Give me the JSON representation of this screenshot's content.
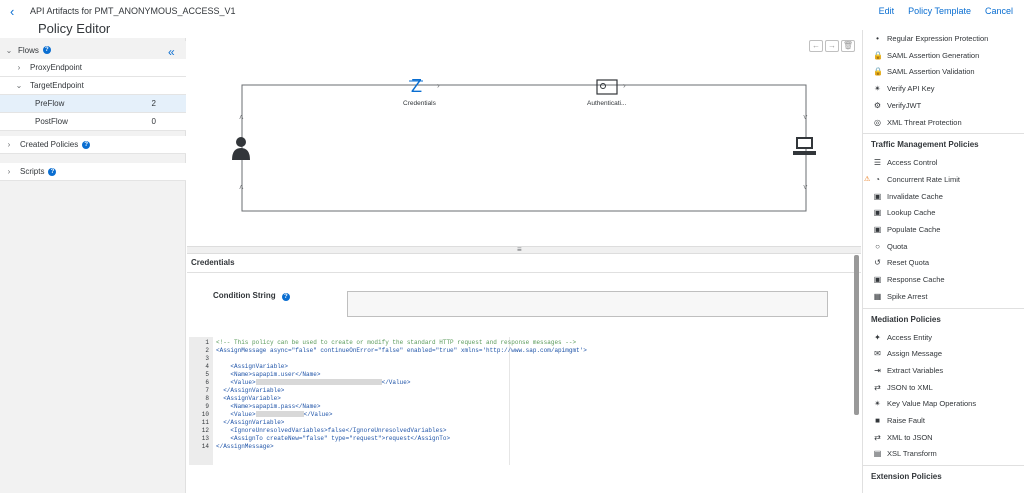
{
  "header": {
    "breadcrumb": "API Artifacts for PMT_ANONYMOUS_ACCESS_V1",
    "title": "Policy Editor",
    "actions": [
      "Edit",
      "Policy Template",
      "Cancel"
    ]
  },
  "sidebar": {
    "flows_label": "Flows",
    "proxy_endpoint": "ProxyEndpoint",
    "target_endpoint": "TargetEndpoint",
    "preflow": "PreFlow",
    "preflow_count": "2",
    "postflow": "PostFlow",
    "postflow_count": "0",
    "created_policies": "Created Policies",
    "scripts": "Scripts"
  },
  "flow": {
    "step1": "Credentials",
    "step2": "Authenticati..."
  },
  "detail": {
    "title": "Credentials",
    "condition_label": "Condition String",
    "condition_value": ""
  },
  "code_lines": [
    {
      "n": "1",
      "text": "<!-- This policy can be used to create or modify the standard HTTP request and response messages -->"
    },
    {
      "n": "2",
      "text": "<AssignMessage async=\"false\" continueOnError=\"false\" enabled=\"true\" xmlns='http://www.sap.com/apimgmt'>"
    },
    {
      "n": "3",
      "text": ""
    },
    {
      "n": "4",
      "text": "    <AssignVariable>"
    },
    {
      "n": "5",
      "text": "    <Name>sapapim.user</Name>"
    },
    {
      "n": "6",
      "text": "    <Value>"
    },
    {
      "n": "7",
      "text": "  </AssignVariable>"
    },
    {
      "n": "8",
      "text": "  <AssignVariable>"
    },
    {
      "n": "9",
      "text": "    <Name>sapapim.pass</Name>"
    },
    {
      "n": "10",
      "text": "    <Value>"
    },
    {
      "n": "11",
      "text": "  </AssignVariable>"
    },
    {
      "n": "12",
      "text": "    <IgnoreUnresolvedVariables>false</IgnoreUnresolvedVariables>"
    },
    {
      "n": "13",
      "text": "    <AssignTo createNew=\"false\" type=\"request\">request</AssignTo>"
    },
    {
      "n": "14",
      "text": "</AssignMessage>"
    }
  ],
  "value_close": "</Value>",
  "policies": {
    "security_items": [
      {
        "label": "Regular Expression Protection",
        "icon": "regex-icon"
      },
      {
        "label": "SAML Assertion Generation",
        "icon": "lock-icon"
      },
      {
        "label": "SAML Assertion Validation",
        "icon": "lock-icon"
      },
      {
        "label": "Verify API Key",
        "icon": "key-icon"
      },
      {
        "label": "VerifyJWT",
        "icon": "gear-icon"
      },
      {
        "label": "XML Threat Protection",
        "icon": "shield-icon"
      }
    ],
    "traffic_header": "Traffic Management Policies",
    "traffic_items": [
      {
        "label": "Access Control",
        "icon": "list-icon"
      },
      {
        "label": "Concurrent Rate Limit",
        "icon": "gauge-icon"
      },
      {
        "label": "Invalidate Cache",
        "icon": "cache-icon"
      },
      {
        "label": "Lookup Cache",
        "icon": "cache-icon"
      },
      {
        "label": "Populate Cache",
        "icon": "cache-icon"
      },
      {
        "label": "Quota",
        "icon": "quota-icon"
      },
      {
        "label": "Reset Quota",
        "icon": "reset-icon"
      },
      {
        "label": "Response Cache",
        "icon": "cache-icon"
      },
      {
        "label": "Spike Arrest",
        "icon": "chart-icon"
      }
    ],
    "mediation_header": "Mediation Policies",
    "mediation_items": [
      {
        "label": "Access Entity",
        "icon": "entity-icon"
      },
      {
        "label": "Assign Message",
        "icon": "message-icon"
      },
      {
        "label": "Extract Variables",
        "icon": "extract-icon"
      },
      {
        "label": "JSON to XML",
        "icon": "convert-icon"
      },
      {
        "label": "Key Value Map Operations",
        "icon": "key-icon"
      },
      {
        "label": "Raise Fault",
        "icon": "fault-icon"
      },
      {
        "label": "XML to JSON",
        "icon": "convert-icon"
      },
      {
        "label": "XSL Transform",
        "icon": "doc-icon"
      }
    ],
    "extension_header": "Extension Policies"
  },
  "colors": {
    "accent": "#0a6ed1",
    "warning": "#e9730c"
  }
}
